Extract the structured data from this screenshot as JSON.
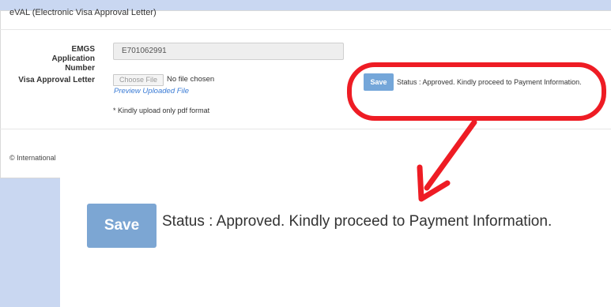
{
  "panel": {
    "title": "eVAL (Electronic Visa Approval Letter)"
  },
  "form": {
    "emgs_label_line1": "EMGS Application",
    "emgs_label_line2": "Number",
    "emgs_value": "E701062991",
    "visa_label": "Visa Approval Letter",
    "choose_file_label": "Choose File",
    "no_file_text": "No file chosen",
    "preview_link": "Preview Uploaded File",
    "note": "* Kindly upload only pdf format"
  },
  "actions": {
    "save_label": "Save",
    "status_text": "Status : Approved. Kindly proceed to Payment Information."
  },
  "footer": {
    "text": "© International"
  },
  "zoom": {
    "save_label": "Save",
    "status_text": "Status : Approved. Kindly proceed to Payment Information."
  },
  "colors": {
    "page_bg": "#c9d7f1",
    "save_button": "#74a6d9",
    "link": "#3a7bd5",
    "annotation_red": "#ee1c24"
  }
}
